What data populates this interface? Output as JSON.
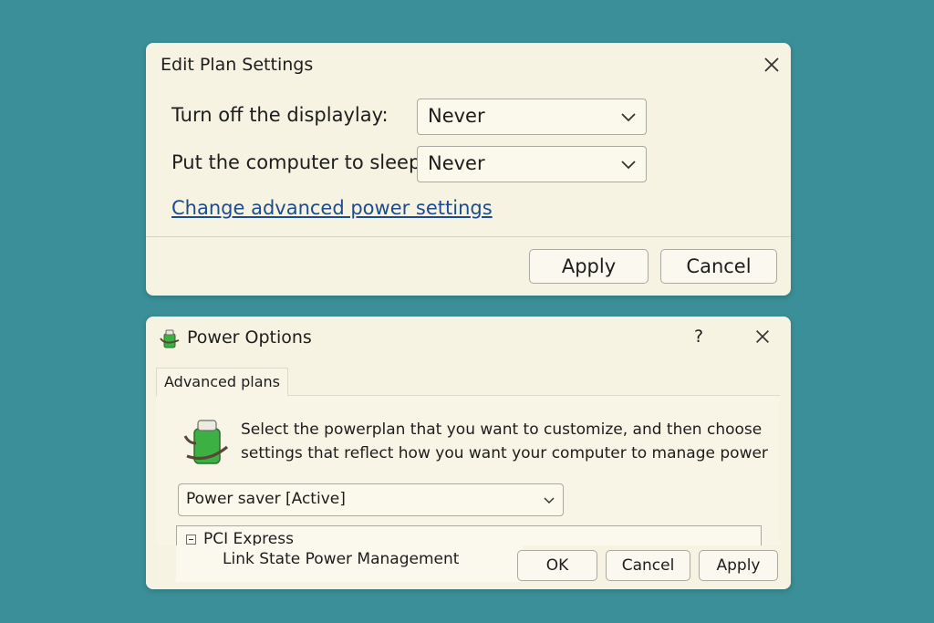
{
  "edit_plan": {
    "title": "Edit Plan Settings",
    "display_label": "Turn off the displaylay:",
    "display_value": "Never",
    "sleep_label": "Put the computer to sleep:",
    "sleep_value": "Never",
    "advanced_link": "Change advanced power settings",
    "apply_label": "Apply",
    "cancel_label": "Cancel",
    "close_icon": "close-icon"
  },
  "power_options": {
    "title": "Power Options",
    "help_label": "?",
    "tab_label": "Advanced plans",
    "description_line1": "Select the powerplan that you want to customize, and then choose",
    "description_line2": "settings that reflect how you want your computer to manage power",
    "plan_value": "Power saver [Active]",
    "tree": {
      "category": "PCI Express",
      "setting": "Link State Power Management"
    },
    "ok_label": "OK",
    "cancel_label": "Cancel",
    "apply_label": "Apply",
    "app_icon": "battery-icon"
  },
  "colors": {
    "background": "#3a8f98",
    "dialog": "#f6f3e2",
    "link": "#1e4b8c",
    "battery_green": "#3cb043"
  }
}
